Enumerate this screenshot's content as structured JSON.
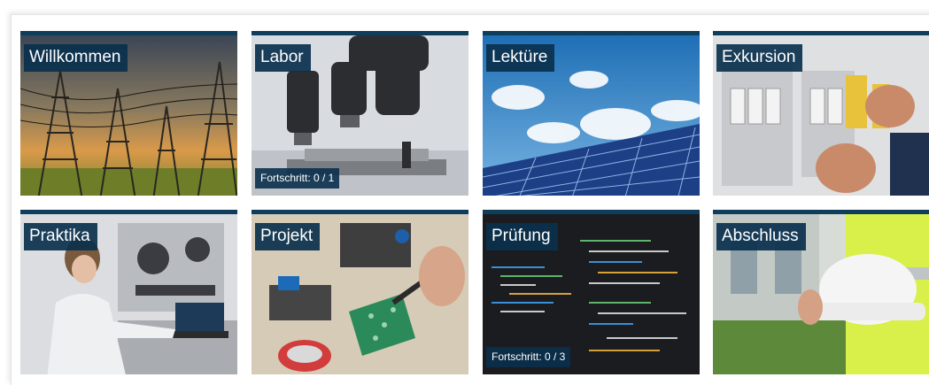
{
  "tiles": [
    {
      "title": "Willkommen",
      "progress": "",
      "image": "power-lines-sunset"
    },
    {
      "title": "Labor",
      "progress": "Fortschritt: 0 / 1",
      "image": "microscope"
    },
    {
      "title": "Lektüre",
      "progress": "",
      "image": "solar-panels"
    },
    {
      "title": "Exkursion",
      "progress": "",
      "image": "electrical-cabinet"
    },
    {
      "title": "Praktika",
      "progress": "",
      "image": "woman-at-laptop-lab"
    },
    {
      "title": "Projekt",
      "progress": "",
      "image": "soldering-circuit-board"
    },
    {
      "title": "Prüfung",
      "progress": "Fortschritt: 0 / 3",
      "image": "code-screen"
    },
    {
      "title": "Abschluss",
      "progress": "",
      "image": "hard-hat-worker"
    }
  ],
  "colors": {
    "banner": "#0f3d5c",
    "label_bg": "#0a304d"
  }
}
